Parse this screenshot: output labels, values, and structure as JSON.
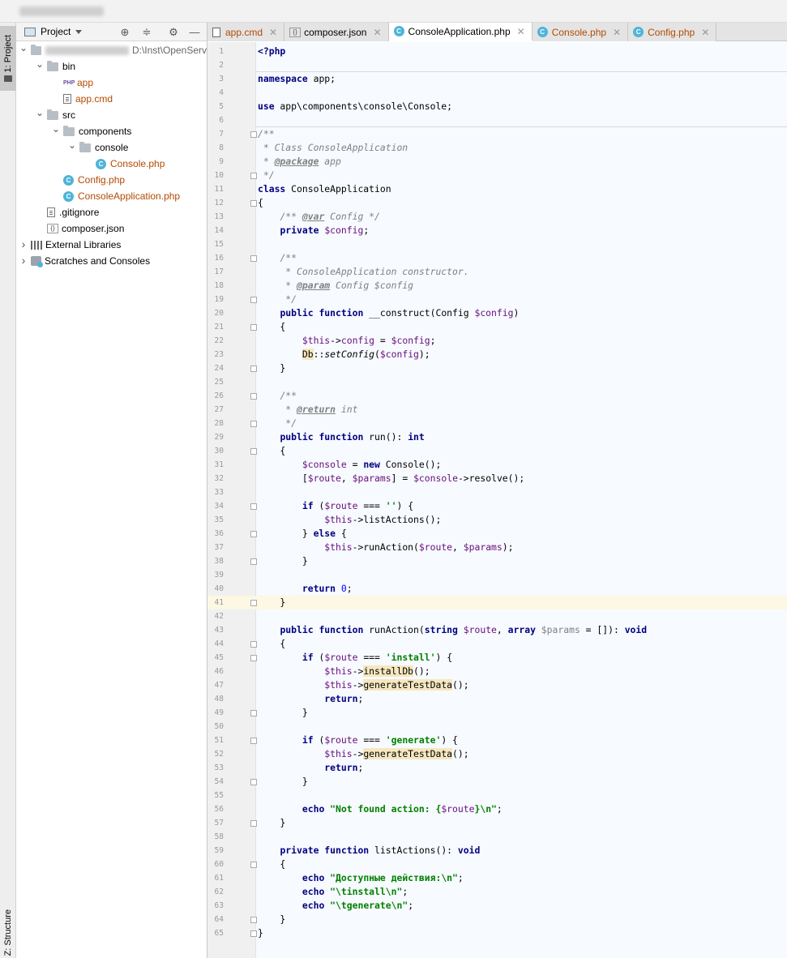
{
  "window": {
    "title_blurred": true
  },
  "side_tabs": {
    "project": "1: Project",
    "structure": "Z: Structure"
  },
  "project_panel": {
    "title": "Project",
    "tree": [
      {
        "label": "",
        "blurred": true,
        "path": "D:\\Inst\\OpenServ",
        "depth": 0,
        "expanded": true,
        "kind": "folder"
      },
      {
        "label": "bin",
        "depth": 1,
        "expanded": true,
        "kind": "folder"
      },
      {
        "label": "app",
        "depth": 2,
        "kind": "php",
        "orange": true
      },
      {
        "label": "app.cmd",
        "depth": 2,
        "kind": "cmd",
        "orange": true
      },
      {
        "label": "src",
        "depth": 1,
        "expanded": true,
        "kind": "folder"
      },
      {
        "label": "components",
        "depth": 2,
        "expanded": true,
        "kind": "folder"
      },
      {
        "label": "console",
        "depth": 3,
        "expanded": true,
        "kind": "folder"
      },
      {
        "label": "Console.php",
        "depth": 4,
        "kind": "class",
        "orange": true
      },
      {
        "label": "Config.php",
        "depth": 2,
        "kind": "class",
        "orange": true
      },
      {
        "label": "ConsoleApplication.php",
        "depth": 2,
        "kind": "class",
        "orange": true
      },
      {
        "label": ".gitignore",
        "depth": 1,
        "kind": "text"
      },
      {
        "label": "composer.json",
        "depth": 1,
        "kind": "json"
      },
      {
        "label": "External Libraries",
        "depth": 0,
        "expanded": false,
        "kind": "libs"
      },
      {
        "label": "Scratches and Consoles",
        "depth": 0,
        "expanded": false,
        "kind": "scratch"
      }
    ]
  },
  "editor_tabs": [
    {
      "label": "app.cmd",
      "icon": "cmd-file-icon",
      "orange": true,
      "active": false
    },
    {
      "label": "composer.json",
      "icon": "json-file-icon",
      "orange": false,
      "active": false
    },
    {
      "label": "ConsoleApplication.php",
      "icon": "php-class-icon",
      "orange": false,
      "active": true
    },
    {
      "label": "Console.php",
      "icon": "php-class-icon",
      "orange": true,
      "active": false
    },
    {
      "label": "Config.php",
      "icon": "php-class-icon",
      "orange": true,
      "active": false
    }
  ],
  "editor": {
    "current_line": 41,
    "separator_after_lines": [
      1,
      5
    ],
    "fold_markers": [
      7,
      10,
      12,
      16,
      19,
      21,
      24,
      26,
      28,
      30,
      34,
      36,
      38,
      41,
      44,
      45,
      49,
      51,
      54,
      57,
      60,
      64,
      65
    ],
    "lines": [
      [
        [
          "kw",
          "<?php"
        ]
      ],
      [],
      [
        [
          "kw",
          "namespace"
        ],
        [
          "",
          "app;"
        ]
      ],
      [],
      [
        [
          "kw",
          "use"
        ],
        [
          "",
          "app\\components\\console\\Console;"
        ]
      ],
      [],
      [
        [
          "cm",
          "/**"
        ]
      ],
      [
        [
          "cm",
          " * Class ConsoleApplication"
        ]
      ],
      [
        [
          "cm",
          " * "
        ],
        [
          "tag",
          "@package"
        ],
        [
          "cm",
          " app"
        ]
      ],
      [
        [
          "cm",
          " */"
        ]
      ],
      [
        [
          "kw",
          "class"
        ],
        [
          "",
          "ConsoleApplication"
        ]
      ],
      [
        [
          "",
          "{"
        ]
      ],
      [
        [
          "",
          "    "
        ],
        [
          "cm",
          "/** "
        ],
        [
          "tag",
          "@var"
        ],
        [
          "cm",
          " Config */"
        ]
      ],
      [
        [
          "",
          "    "
        ],
        [
          "kw",
          "private"
        ],
        [
          "",
          " "
        ],
        [
          "v",
          "$config"
        ],
        [
          "",
          ";"
        ]
      ],
      [],
      [
        [
          "",
          "    "
        ],
        [
          "cm",
          "/**"
        ]
      ],
      [
        [
          "",
          "    "
        ],
        [
          "cm",
          " * ConsoleApplication constructor."
        ]
      ],
      [
        [
          "",
          "    "
        ],
        [
          "cm",
          " * "
        ],
        [
          "tag",
          "@param"
        ],
        [
          "cm",
          " Config $config"
        ]
      ],
      [
        [
          "",
          "    "
        ],
        [
          "cm",
          " */"
        ]
      ],
      [
        [
          "",
          "    "
        ],
        [
          "kw",
          "public function"
        ],
        [
          "",
          " __construct(Config "
        ],
        [
          "v",
          "$config"
        ],
        [
          "",
          ")"
        ]
      ],
      [
        [
          "",
          "    {"
        ]
      ],
      [
        [
          "",
          "        "
        ],
        [
          "v",
          "$this"
        ],
        [
          "",
          "->"
        ],
        [
          "v",
          "config"
        ],
        [
          "",
          " = "
        ],
        [
          "v",
          "$config"
        ],
        [
          "",
          ";"
        ]
      ],
      [
        [
          "",
          "        "
        ],
        [
          "hl",
          "Db"
        ],
        [
          "",
          "::"
        ],
        [
          "it",
          "setConfig"
        ],
        [
          "",
          "("
        ],
        [
          "v",
          "$config"
        ],
        [
          "",
          ");"
        ]
      ],
      [
        [
          "",
          "    }"
        ]
      ],
      [],
      [
        [
          "",
          "    "
        ],
        [
          "cm",
          "/**"
        ]
      ],
      [
        [
          "",
          "    "
        ],
        [
          "cm",
          " * "
        ],
        [
          "tag",
          "@return"
        ],
        [
          "cm",
          " int"
        ]
      ],
      [
        [
          "",
          "    "
        ],
        [
          "cm",
          " */"
        ]
      ],
      [
        [
          "",
          "    "
        ],
        [
          "kw",
          "public function"
        ],
        [
          "",
          " run(): "
        ],
        [
          "kw",
          "int"
        ]
      ],
      [
        [
          "",
          "    {"
        ]
      ],
      [
        [
          "",
          "        "
        ],
        [
          "v",
          "$console"
        ],
        [
          "",
          " = "
        ],
        [
          "kw",
          "new"
        ],
        [
          "",
          " Console();"
        ]
      ],
      [
        [
          "",
          "        ["
        ],
        [
          "v",
          "$route"
        ],
        [
          "",
          ", "
        ],
        [
          "v",
          "$params"
        ],
        [
          "",
          "] = "
        ],
        [
          "v",
          "$console"
        ],
        [
          "",
          "->resolve();"
        ]
      ],
      [],
      [
        [
          "",
          "        "
        ],
        [
          "kw",
          "if"
        ],
        [
          "",
          " ("
        ],
        [
          "v",
          "$route"
        ],
        [
          "",
          " === "
        ],
        [
          "str",
          "''"
        ],
        [
          "",
          ") {"
        ]
      ],
      [
        [
          "",
          "            "
        ],
        [
          "v",
          "$this"
        ],
        [
          "",
          "->listActions();"
        ]
      ],
      [
        [
          "",
          "        } "
        ],
        [
          "kw",
          "else"
        ],
        [
          "",
          " {"
        ]
      ],
      [
        [
          "",
          "            "
        ],
        [
          "v",
          "$this"
        ],
        [
          "",
          "->runAction("
        ],
        [
          "v",
          "$route"
        ],
        [
          "",
          ", "
        ],
        [
          "v",
          "$params"
        ],
        [
          "",
          ");"
        ]
      ],
      [
        [
          "",
          "        }"
        ]
      ],
      [],
      [
        [
          "",
          "        "
        ],
        [
          "kw",
          "return"
        ],
        [
          "",
          " "
        ],
        [
          "num",
          "0"
        ],
        [
          "",
          ";"
        ]
      ],
      [
        [
          "",
          "    }"
        ]
      ],
      [],
      [
        [
          "",
          "    "
        ],
        [
          "kw",
          "public function"
        ],
        [
          "",
          " runAction("
        ],
        [
          "kw",
          "string"
        ],
        [
          "",
          " "
        ],
        [
          "v",
          "$route"
        ],
        [
          "",
          ", "
        ],
        [
          "kw",
          "array"
        ],
        [
          "",
          " "
        ],
        [
          "ph",
          "$params"
        ],
        [
          "",
          " = []): "
        ],
        [
          "kw",
          "void"
        ]
      ],
      [
        [
          "",
          "    {"
        ]
      ],
      [
        [
          "",
          "        "
        ],
        [
          "kw",
          "if"
        ],
        [
          "",
          " ("
        ],
        [
          "v",
          "$route"
        ],
        [
          "",
          " === "
        ],
        [
          "str",
          "'install'"
        ],
        [
          "",
          ") {"
        ]
      ],
      [
        [
          "",
          "            "
        ],
        [
          "v",
          "$this"
        ],
        [
          "",
          "->"
        ],
        [
          "hl",
          "installDb"
        ],
        [
          "",
          "();"
        ]
      ],
      [
        [
          "",
          "            "
        ],
        [
          "v",
          "$this"
        ],
        [
          "",
          "->"
        ],
        [
          "hl",
          "generateTestData"
        ],
        [
          "",
          "();"
        ]
      ],
      [
        [
          "",
          "            "
        ],
        [
          "kw",
          "return"
        ],
        [
          "",
          ";"
        ]
      ],
      [
        [
          "",
          "        }"
        ]
      ],
      [],
      [
        [
          "",
          "        "
        ],
        [
          "kw",
          "if"
        ],
        [
          "",
          " ("
        ],
        [
          "v",
          "$route"
        ],
        [
          "",
          " === "
        ],
        [
          "str",
          "'generate'"
        ],
        [
          "",
          ") {"
        ]
      ],
      [
        [
          "",
          "            "
        ],
        [
          "v",
          "$this"
        ],
        [
          "",
          "->"
        ],
        [
          "hl",
          "generateTestData"
        ],
        [
          "",
          "();"
        ]
      ],
      [
        [
          "",
          "            "
        ],
        [
          "kw",
          "return"
        ],
        [
          "",
          ";"
        ]
      ],
      [
        [
          "",
          "        }"
        ]
      ],
      [],
      [
        [
          "",
          "        "
        ],
        [
          "kw",
          "echo"
        ],
        [
          "",
          " "
        ],
        [
          "str",
          "\"Not found action: {"
        ],
        [
          "v",
          "$route"
        ],
        [
          "str",
          "}\\n\""
        ],
        [
          "",
          ";"
        ]
      ],
      [
        [
          "",
          "    }"
        ]
      ],
      [],
      [
        [
          "",
          "    "
        ],
        [
          "kw",
          "private function"
        ],
        [
          "",
          " listActions(): "
        ],
        [
          "kw",
          "void"
        ]
      ],
      [
        [
          "",
          "    {"
        ]
      ],
      [
        [
          "",
          "        "
        ],
        [
          "kw",
          "echo"
        ],
        [
          "",
          " "
        ],
        [
          "str",
          "\"Доступные действия:\\n\""
        ],
        [
          "",
          ";"
        ]
      ],
      [
        [
          "",
          "        "
        ],
        [
          "kw",
          "echo"
        ],
        [
          "",
          " "
        ],
        [
          "str",
          "\"\\tinstall\\n\""
        ],
        [
          "",
          ";"
        ]
      ],
      [
        [
          "",
          "        "
        ],
        [
          "kw",
          "echo"
        ],
        [
          "",
          " "
        ],
        [
          "str",
          "\"\\tgenerate\\n\""
        ],
        [
          "",
          ";"
        ]
      ],
      [
        [
          "",
          "    }"
        ]
      ],
      [
        [
          "",
          "}"
        ]
      ]
    ]
  }
}
